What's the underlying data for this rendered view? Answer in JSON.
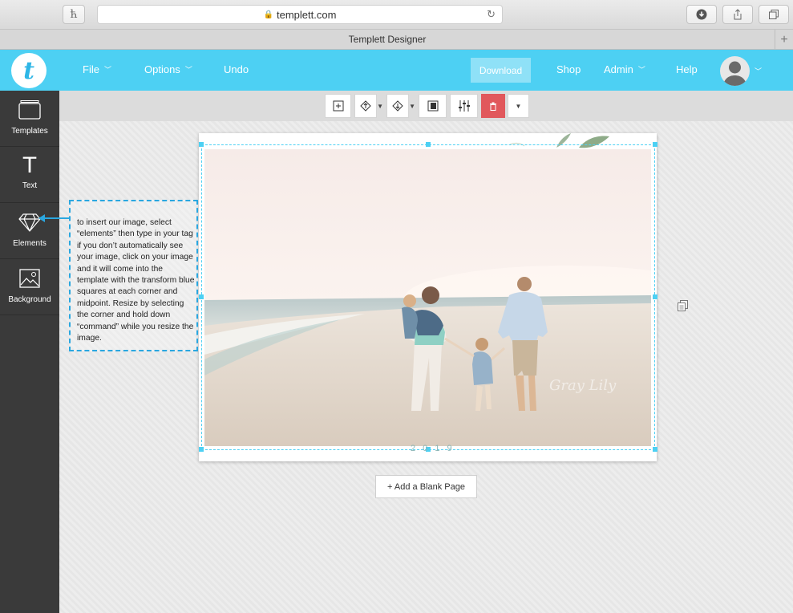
{
  "browser": {
    "url": "templett.com",
    "tab_title": "Templett Designer",
    "left_button_glyph": "ћ"
  },
  "navbar": {
    "logo_letter": "t",
    "menu": [
      {
        "label": "File",
        "dropdown": true
      },
      {
        "label": "Options",
        "dropdown": true
      },
      {
        "label": "Undo",
        "dropdown": false
      }
    ],
    "download_label": "Download",
    "right_menu": [
      {
        "label": "Shop",
        "dropdown": false
      },
      {
        "label": "Admin",
        "dropdown": true
      },
      {
        "label": "Help",
        "dropdown": false
      }
    ]
  },
  "sidebar": {
    "items": [
      {
        "label": "Templates",
        "icon": "templates-icon"
      },
      {
        "label": "Text",
        "icon": "text-icon",
        "glyph": "T"
      },
      {
        "label": "Elements",
        "icon": "diamond-icon"
      },
      {
        "label": "Background",
        "icon": "image-icon"
      }
    ]
  },
  "toolbar": {
    "buttons": [
      "add-page",
      "bring-forward",
      "send-backward",
      "spot-color",
      "adjustments",
      "delete",
      "more"
    ]
  },
  "canvas": {
    "page_number": "2 0 1 9",
    "add_page_label": "+ Add a Blank Page",
    "watermark": "Gray Lily"
  },
  "annotation": {
    "text": "to insert our image, select “elements” then type in your tag if you don’t automatically see your image, click on your image and it will come into the template with the transform blue squares at each corner and midpoint. Resize by selecting the corner and hold down “command” while you resize the image."
  },
  "colors": {
    "accent": "#4dd0f3",
    "sidebar": "#3a3a3a",
    "delete": "#e1585c",
    "annotation": "#2aa7e0"
  }
}
